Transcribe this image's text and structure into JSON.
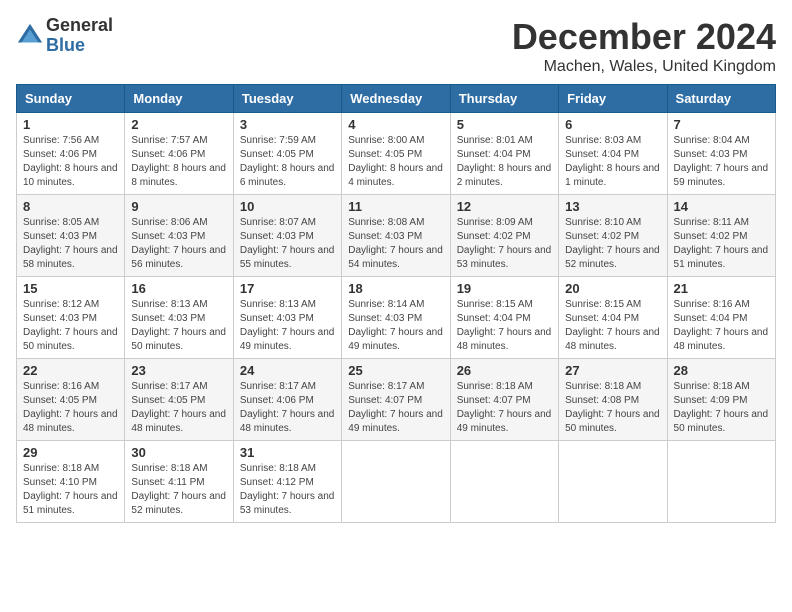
{
  "logo": {
    "general": "General",
    "blue": "Blue"
  },
  "title": "December 2024",
  "location": "Machen, Wales, United Kingdom",
  "days_of_week": [
    "Sunday",
    "Monday",
    "Tuesday",
    "Wednesday",
    "Thursday",
    "Friday",
    "Saturday"
  ],
  "weeks": [
    [
      {
        "day": "1",
        "sunrise": "7:56 AM",
        "sunset": "4:06 PM",
        "daylight": "8 hours and 10 minutes."
      },
      {
        "day": "2",
        "sunrise": "7:57 AM",
        "sunset": "4:06 PM",
        "daylight": "8 hours and 8 minutes."
      },
      {
        "day": "3",
        "sunrise": "7:59 AM",
        "sunset": "4:05 PM",
        "daylight": "8 hours and 6 minutes."
      },
      {
        "day": "4",
        "sunrise": "8:00 AM",
        "sunset": "4:05 PM",
        "daylight": "8 hours and 4 minutes."
      },
      {
        "day": "5",
        "sunrise": "8:01 AM",
        "sunset": "4:04 PM",
        "daylight": "8 hours and 2 minutes."
      },
      {
        "day": "6",
        "sunrise": "8:03 AM",
        "sunset": "4:04 PM",
        "daylight": "8 hours and 1 minute."
      },
      {
        "day": "7",
        "sunrise": "8:04 AM",
        "sunset": "4:03 PM",
        "daylight": "7 hours and 59 minutes."
      }
    ],
    [
      {
        "day": "8",
        "sunrise": "8:05 AM",
        "sunset": "4:03 PM",
        "daylight": "7 hours and 58 minutes."
      },
      {
        "day": "9",
        "sunrise": "8:06 AM",
        "sunset": "4:03 PM",
        "daylight": "7 hours and 56 minutes."
      },
      {
        "day": "10",
        "sunrise": "8:07 AM",
        "sunset": "4:03 PM",
        "daylight": "7 hours and 55 minutes."
      },
      {
        "day": "11",
        "sunrise": "8:08 AM",
        "sunset": "4:03 PM",
        "daylight": "7 hours and 54 minutes."
      },
      {
        "day": "12",
        "sunrise": "8:09 AM",
        "sunset": "4:02 PM",
        "daylight": "7 hours and 53 minutes."
      },
      {
        "day": "13",
        "sunrise": "8:10 AM",
        "sunset": "4:02 PM",
        "daylight": "7 hours and 52 minutes."
      },
      {
        "day": "14",
        "sunrise": "8:11 AM",
        "sunset": "4:02 PM",
        "daylight": "7 hours and 51 minutes."
      }
    ],
    [
      {
        "day": "15",
        "sunrise": "8:12 AM",
        "sunset": "4:03 PM",
        "daylight": "7 hours and 50 minutes."
      },
      {
        "day": "16",
        "sunrise": "8:13 AM",
        "sunset": "4:03 PM",
        "daylight": "7 hours and 50 minutes."
      },
      {
        "day": "17",
        "sunrise": "8:13 AM",
        "sunset": "4:03 PM",
        "daylight": "7 hours and 49 minutes."
      },
      {
        "day": "18",
        "sunrise": "8:14 AM",
        "sunset": "4:03 PM",
        "daylight": "7 hours and 49 minutes."
      },
      {
        "day": "19",
        "sunrise": "8:15 AM",
        "sunset": "4:04 PM",
        "daylight": "7 hours and 48 minutes."
      },
      {
        "day": "20",
        "sunrise": "8:15 AM",
        "sunset": "4:04 PM",
        "daylight": "7 hours and 48 minutes."
      },
      {
        "day": "21",
        "sunrise": "8:16 AM",
        "sunset": "4:04 PM",
        "daylight": "7 hours and 48 minutes."
      }
    ],
    [
      {
        "day": "22",
        "sunrise": "8:16 AM",
        "sunset": "4:05 PM",
        "daylight": "7 hours and 48 minutes."
      },
      {
        "day": "23",
        "sunrise": "8:17 AM",
        "sunset": "4:05 PM",
        "daylight": "7 hours and 48 minutes."
      },
      {
        "day": "24",
        "sunrise": "8:17 AM",
        "sunset": "4:06 PM",
        "daylight": "7 hours and 48 minutes."
      },
      {
        "day": "25",
        "sunrise": "8:17 AM",
        "sunset": "4:07 PM",
        "daylight": "7 hours and 49 minutes."
      },
      {
        "day": "26",
        "sunrise": "8:18 AM",
        "sunset": "4:07 PM",
        "daylight": "7 hours and 49 minutes."
      },
      {
        "day": "27",
        "sunrise": "8:18 AM",
        "sunset": "4:08 PM",
        "daylight": "7 hours and 50 minutes."
      },
      {
        "day": "28",
        "sunrise": "8:18 AM",
        "sunset": "4:09 PM",
        "daylight": "7 hours and 50 minutes."
      }
    ],
    [
      {
        "day": "29",
        "sunrise": "8:18 AM",
        "sunset": "4:10 PM",
        "daylight": "7 hours and 51 minutes."
      },
      {
        "day": "30",
        "sunrise": "8:18 AM",
        "sunset": "4:11 PM",
        "daylight": "7 hours and 52 minutes."
      },
      {
        "day": "31",
        "sunrise": "8:18 AM",
        "sunset": "4:12 PM",
        "daylight": "7 hours and 53 minutes."
      },
      null,
      null,
      null,
      null
    ]
  ]
}
